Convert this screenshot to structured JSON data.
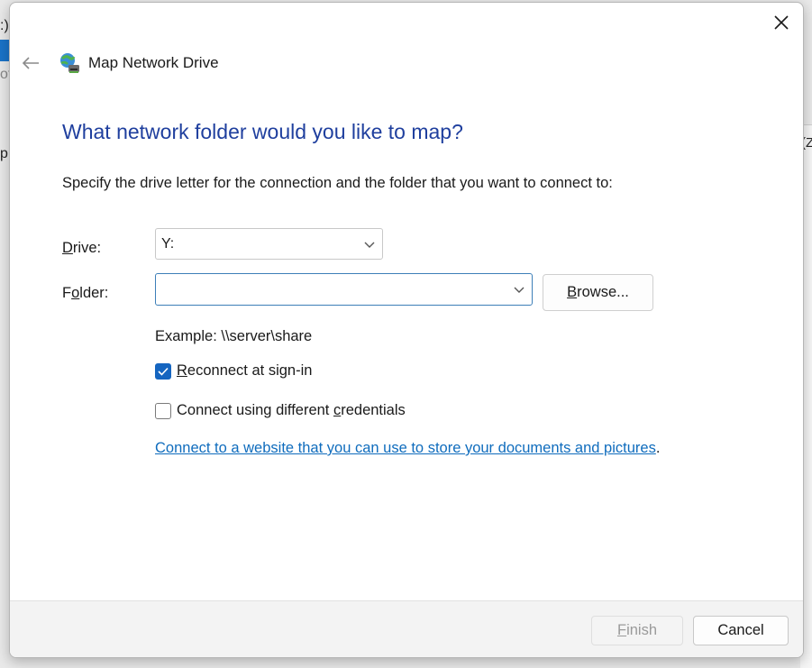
{
  "background": {
    "frag_top": ":)",
    "frag_sub": "of",
    "frag_left": "p",
    "frag_right": "(Z"
  },
  "dialog": {
    "title": "Map Network Drive",
    "heading": "What network folder would you like to map?",
    "instruction": "Specify the drive letter for the connection and the folder that you want to connect to:",
    "drive": {
      "label_key": "D",
      "label_rest": "rive:",
      "value": "Y:"
    },
    "folder": {
      "label_pre": "F",
      "label_key": "o",
      "label_rest": "lder:",
      "value": ""
    },
    "browse": {
      "label_key": "B",
      "label_rest": "rowse..."
    },
    "example": "Example: \\\\server\\share",
    "reconnect": {
      "checked": true,
      "label_key": "R",
      "label_rest": "econnect at sign-in"
    },
    "credentials": {
      "checked": false,
      "label_pre": "Connect using different ",
      "label_key": "c",
      "label_rest": "redentials"
    },
    "website_link": "Connect to a website that you can use to store your documents and pictures",
    "website_link_suffix": "."
  },
  "footer": {
    "finish_key": "F",
    "finish_rest": "inish",
    "cancel": "Cancel"
  },
  "colors": {
    "heading": "#1f3f9e",
    "link": "#0f6cbd",
    "checkbox_checked": "#1565c0"
  },
  "icons": {
    "close": "close-icon",
    "back": "back-arrow-icon",
    "title": "network-drive-icon",
    "dropdown": "chevron-down-icon",
    "check": "checkmark-icon"
  }
}
